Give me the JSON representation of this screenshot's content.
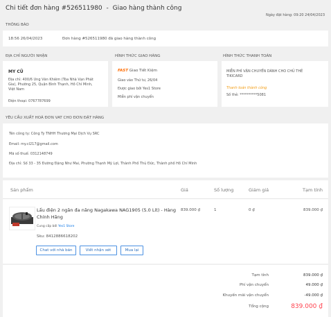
{
  "header": {
    "title": "Chi tiết đơn hàng #526511980",
    "separator": "-",
    "status": "Giao hàng thành công",
    "order_date": "Ngày đặt hàng: 09:20 24/04/2023"
  },
  "notifications": {
    "heading": "THÔNG BÁO",
    "time": "18:56 26/04/2023",
    "message": "Đơn hàng #526511980 đã giao hàng thành công"
  },
  "address": {
    "heading": "ĐỊA CHỈ NGƯỜI NHẬN",
    "name": "MY CŨ",
    "line1": "Địa chỉ: 400/6 Ung Văn Khiêm (Tòa Nhà Vạn Phát",
    "line2": "Gia), Phường 25, Quận Bình Thạnh, Hồ Chí Minh,",
    "line3": "Việt Nam",
    "phone": "Điện thoại: 0767787699"
  },
  "shipping": {
    "heading": "HÌNH THỨC GIAO HÀNG",
    "fast": "FAST",
    "method": "Giao Tiết Kiệm",
    "delivery": "Giao vào Thứ tư, 26/04",
    "provider": "Được giao bởi Yes1 Store",
    "fee": "Miễn phí vận chuyển"
  },
  "payment": {
    "heading": "HÌNH THỨC THANH TOÁN",
    "line1": "MIỄN PHÍ VẬN CHUYỂN DÀNH CHO CHỦ THẺ",
    "line2": "TIKICARD",
    "status": "Thanh toán thành công",
    "card": "Số thẻ: **********5081"
  },
  "invoice": {
    "heading": "YÊU CẦU XUẤT HOÁ ĐƠN VAT CHO ĐƠN ĐẶT HÀNG",
    "company": "Tên công ty: Công Ty TNHH Thương Mại Dịch Vụ SRC",
    "email": "Email: my.cl217@gmail.com",
    "tax": "Mã số thuế: 0312148749",
    "addr": "Địa chỉ: Số 33 - 35 Đường Đặng Như Mai, Phường Thạnh Mỹ Lợi, Thành Phố Thủ Đức, Thành phố Hồ Chí Minh"
  },
  "table": {
    "headers": {
      "product": "Sản phẩm",
      "price": "Giá",
      "qty": "Số lượng",
      "discount": "Giảm giá",
      "subtotal": "Tạm tính"
    },
    "product": {
      "name1": "Lẩu điện 2 ngăn đa năng Nagakawa NAG1905 (5.0 Lít) - Hàng",
      "name2": "Chính Hãng",
      "supplier_label": "Cung cấp bởi",
      "supplier": "Yes1 Store",
      "sku": "Sku: 8412886618202",
      "price": "839.000 ₫",
      "qty": "1",
      "discount": "0 ₫",
      "subtotal": "839.000 ₫",
      "buttons": [
        "Chat với nhà bán",
        "Viết nhận xét",
        "Mua lại"
      ]
    }
  },
  "totals": {
    "rows": [
      {
        "label": "Tạm tính",
        "value": "839.000 ₫"
      },
      {
        "label": "Phí vận chuyển",
        "value": "49.000 ₫"
      },
      {
        "label": "Khuyến mãi vận chuyển",
        "value": "-49.000 ₫"
      }
    ],
    "total_label": "Tổng cộng",
    "total_value": "839.000 ₫"
  },
  "colors": {
    "accent": "#ff424e",
    "link": "#0b74e5",
    "orange": "#f39c12"
  }
}
